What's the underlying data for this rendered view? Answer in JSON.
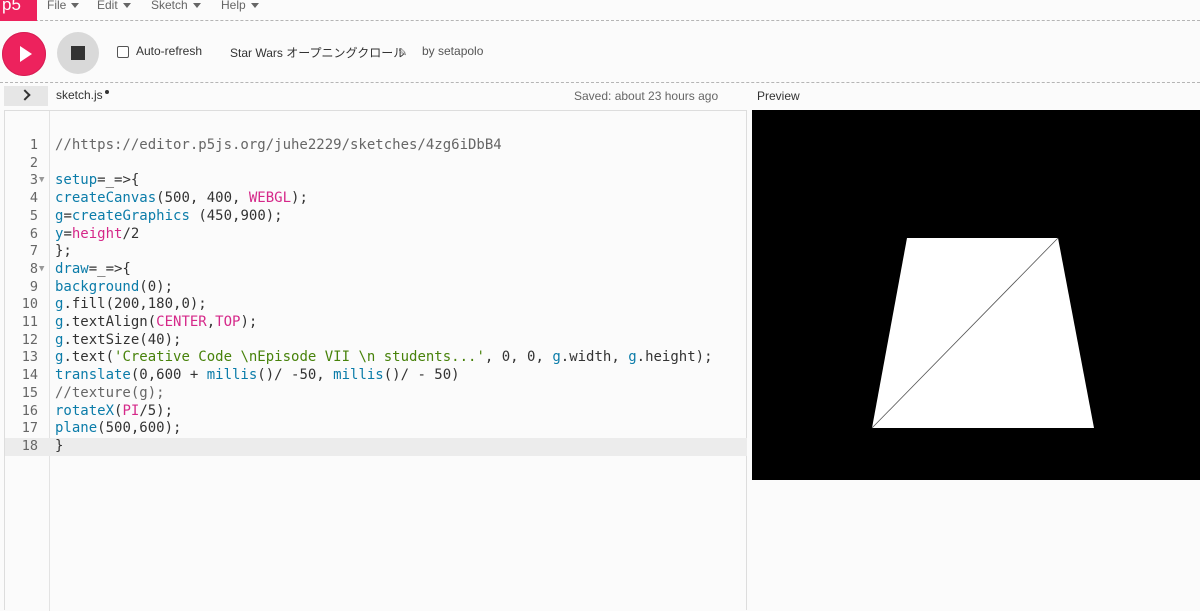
{
  "nav": {
    "logo_text": "p5",
    "menus": [
      {
        "label": "File"
      },
      {
        "label": "Edit"
      },
      {
        "label": "Sketch"
      },
      {
        "label": "Help"
      }
    ]
  },
  "toolbar": {
    "auto_refresh_label": "Auto-refresh",
    "auto_refresh_checked": false,
    "sketch_title": "Star Wars オープニングクロール",
    "author": "by setapolo"
  },
  "editor": {
    "file_name": "sketch.js",
    "saved_status": "Saved: about 23 hours ago",
    "preview_label": "Preview",
    "active_line": 18,
    "lines": [
      {
        "num": "1",
        "tokens": [
          {
            "t": "//https://editor.p5js.org/juhe2229/sketches/4zg6iDbB4",
            "c": "cm"
          }
        ]
      },
      {
        "num": "2",
        "tokens": []
      },
      {
        "num": "3",
        "fold": true,
        "tokens": [
          {
            "t": "setup",
            "c": "kw"
          },
          {
            "t": "=_=>{",
            "c": "df"
          }
        ]
      },
      {
        "num": "4",
        "tokens": [
          {
            "t": "createCanvas",
            "c": "kw"
          },
          {
            "t": "(500, 400, ",
            "c": "df"
          },
          {
            "t": "WEBGL",
            "c": "cn"
          },
          {
            "t": ");",
            "c": "df"
          }
        ]
      },
      {
        "num": "5",
        "tokens": [
          {
            "t": "g",
            "c": "kw"
          },
          {
            "t": "=",
            "c": "df"
          },
          {
            "t": "createGraphics",
            "c": "kw"
          },
          {
            "t": " (450,900);",
            "c": "df"
          }
        ]
      },
      {
        "num": "6",
        "tokens": [
          {
            "t": "y",
            "c": "kw"
          },
          {
            "t": "=",
            "c": "df"
          },
          {
            "t": "height",
            "c": "cn"
          },
          {
            "t": "/2",
            "c": "df"
          }
        ]
      },
      {
        "num": "7",
        "tokens": [
          {
            "t": "};",
            "c": "df"
          }
        ]
      },
      {
        "num": "8",
        "fold": true,
        "tokens": [
          {
            "t": "draw",
            "c": "kw"
          },
          {
            "t": "=_=>{",
            "c": "df"
          }
        ]
      },
      {
        "num": "9",
        "tokens": [
          {
            "t": "background",
            "c": "kw"
          },
          {
            "t": "(0);",
            "c": "df"
          }
        ]
      },
      {
        "num": "10",
        "tokens": [
          {
            "t": "g",
            "c": "kw"
          },
          {
            "t": ".fill(200,180,0);",
            "c": "df"
          }
        ]
      },
      {
        "num": "11",
        "tokens": [
          {
            "t": "g",
            "c": "kw"
          },
          {
            "t": ".textAlign(",
            "c": "df"
          },
          {
            "t": "CENTER",
            "c": "cn"
          },
          {
            "t": ",",
            "c": "df"
          },
          {
            "t": "TOP",
            "c": "cn"
          },
          {
            "t": ");",
            "c": "df"
          }
        ]
      },
      {
        "num": "12",
        "tokens": [
          {
            "t": "g",
            "c": "kw"
          },
          {
            "t": ".textSize(40);",
            "c": "df"
          }
        ]
      },
      {
        "num": "13",
        "tokens": [
          {
            "t": "g",
            "c": "kw"
          },
          {
            "t": ".text(",
            "c": "df"
          },
          {
            "t": "'Creative Code \\nEpisode VII \\n students...'",
            "c": "st"
          },
          {
            "t": ", 0, 0, ",
            "c": "df"
          },
          {
            "t": "g",
            "c": "kw"
          },
          {
            "t": ".width, ",
            "c": "df"
          },
          {
            "t": "g",
            "c": "kw"
          },
          {
            "t": ".height);",
            "c": "df"
          }
        ]
      },
      {
        "num": "14",
        "tokens": [
          {
            "t": "translate",
            "c": "kw"
          },
          {
            "t": "(0,600 + ",
            "c": "df"
          },
          {
            "t": "millis",
            "c": "kw"
          },
          {
            "t": "()/ -50, ",
            "c": "df"
          },
          {
            "t": "millis",
            "c": "kw"
          },
          {
            "t": "()/ - 50)",
            "c": "df"
          }
        ]
      },
      {
        "num": "15",
        "tokens": [
          {
            "t": "//texture(g);",
            "c": "cm"
          }
        ]
      },
      {
        "num": "16",
        "tokens": [
          {
            "t": "rotateX",
            "c": "kw"
          },
          {
            "t": "(",
            "c": "df"
          },
          {
            "t": "PI",
            "c": "cn"
          },
          {
            "t": "/5);",
            "c": "df"
          }
        ]
      },
      {
        "num": "17",
        "tokens": [
          {
            "t": "plane",
            "c": "kw"
          },
          {
            "t": "(500,600);",
            "c": "df"
          }
        ]
      },
      {
        "num": "18",
        "tokens": [
          {
            "t": "}",
            "c": "df"
          }
        ]
      }
    ]
  },
  "colors": {
    "accent": "#ed225d",
    "keyword": "#0b7ca9",
    "constant": "#d52889",
    "string": "#47820a",
    "comment": "#666666"
  }
}
